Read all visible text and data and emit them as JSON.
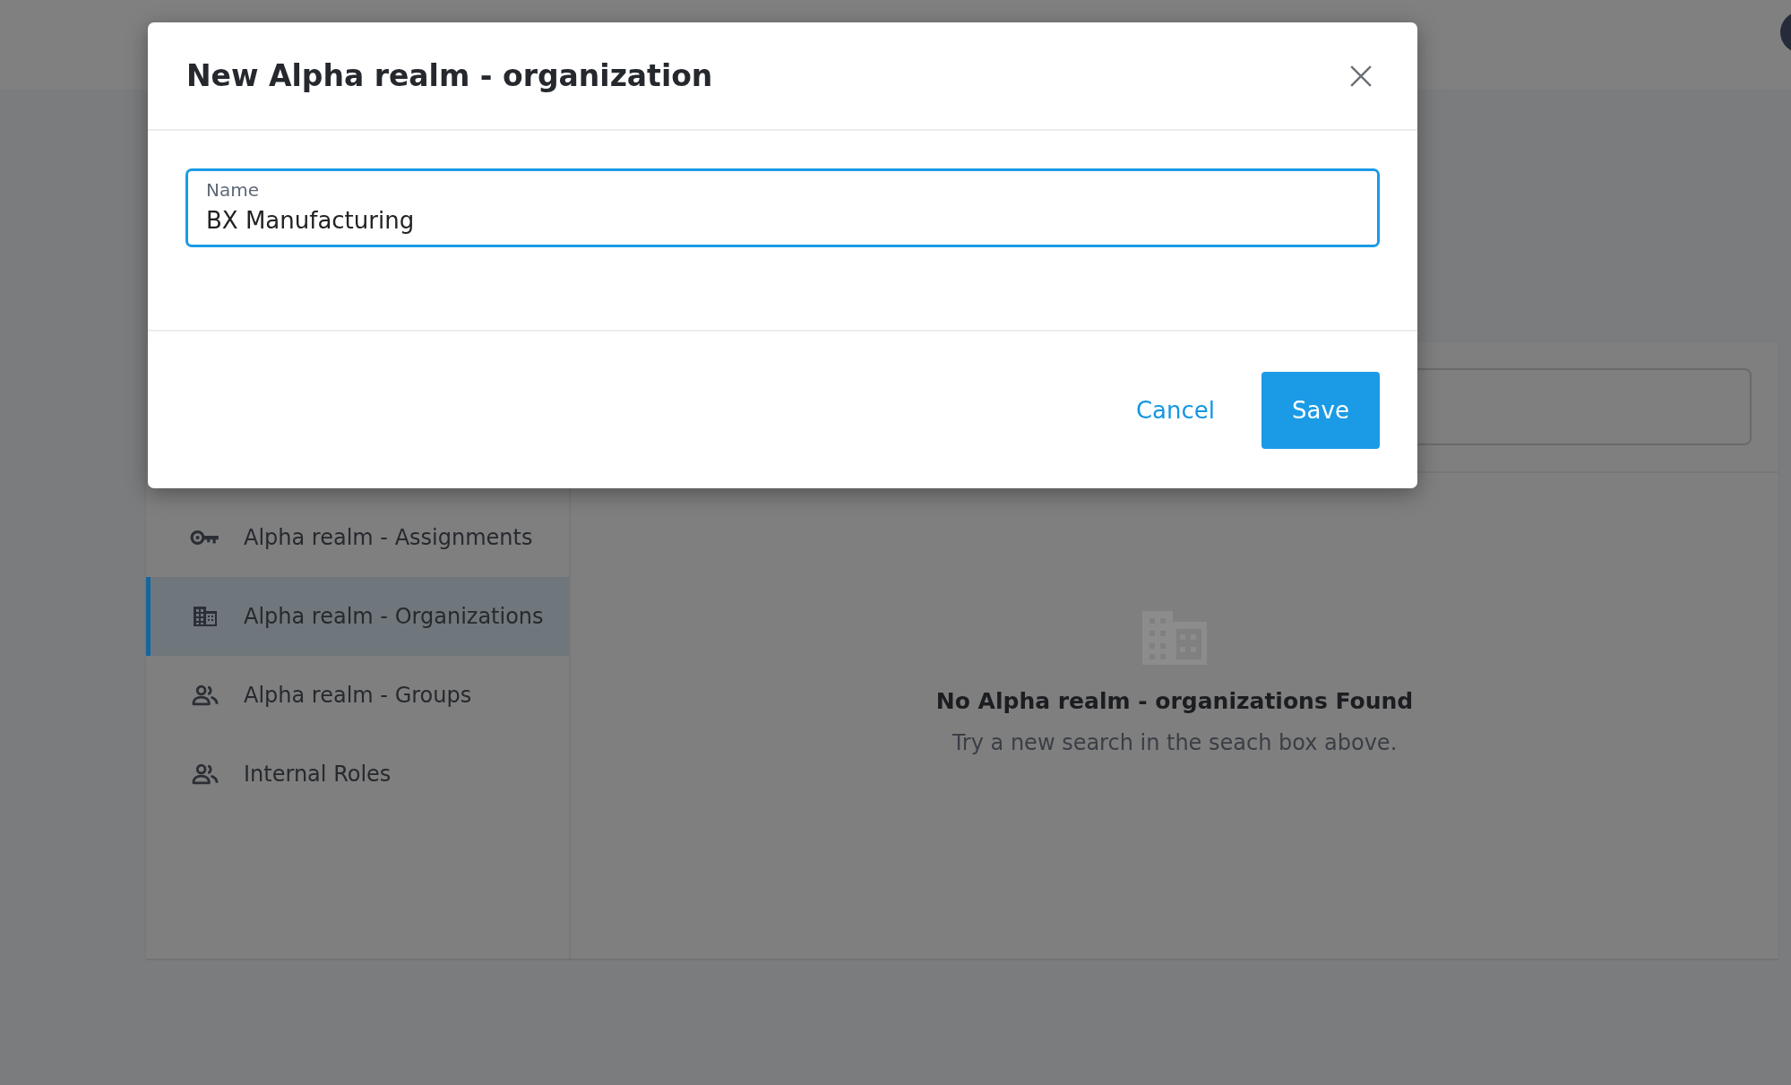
{
  "dialog": {
    "title": "New Alpha realm - organization",
    "field": {
      "label": "Name",
      "value": "BX Manufacturing",
      "focused": true
    },
    "buttons": [
      {
        "label": "Cancel",
        "kind": "link"
      },
      {
        "label": "Save",
        "kind": "primary"
      }
    ]
  },
  "sidebar": {
    "items": [
      {
        "label": "Alpha realm - Assignments",
        "kind": "key",
        "selected": false
      },
      {
        "label": "Alpha realm - Organizations",
        "kind": "building",
        "selected": true
      },
      {
        "label": "Alpha realm - Groups",
        "kind": "people",
        "selected": false
      },
      {
        "label": "Internal Roles",
        "kind": "people",
        "selected": false
      }
    ]
  },
  "empty_state": {
    "title": "No Alpha realm - organizations Found",
    "message": "Try a new search in the seach box above."
  }
}
